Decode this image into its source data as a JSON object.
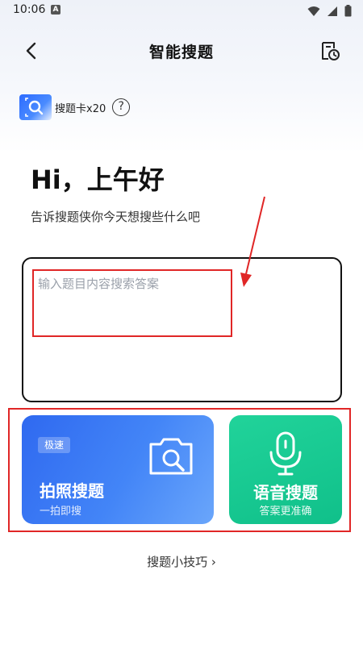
{
  "status_bar": {
    "time": "10:06",
    "app_icon_letter": "A"
  },
  "nav": {
    "title": "智能搜题"
  },
  "search_card": {
    "label": "搜题卡x20",
    "help_symbol": "?"
  },
  "greeting": {
    "title": "Hi，上午好",
    "subtitle": "告诉搜题侠你今天想搜些什么吧"
  },
  "input": {
    "placeholder": "输入题目内容搜索答案",
    "value": ""
  },
  "photo_search": {
    "badge": "极速",
    "label": "拍照搜题",
    "sub_label": "一拍即搜",
    "color": "#3b78f5",
    "icon": "camera-search-icon"
  },
  "voice_search": {
    "label": "语音搜题",
    "sub_label": "答案更准确",
    "color": "#18c891",
    "icon": "microphone-icon"
  },
  "tips": {
    "label": "搜题小技巧 ›"
  },
  "annotations": {
    "color": "#e02626"
  }
}
